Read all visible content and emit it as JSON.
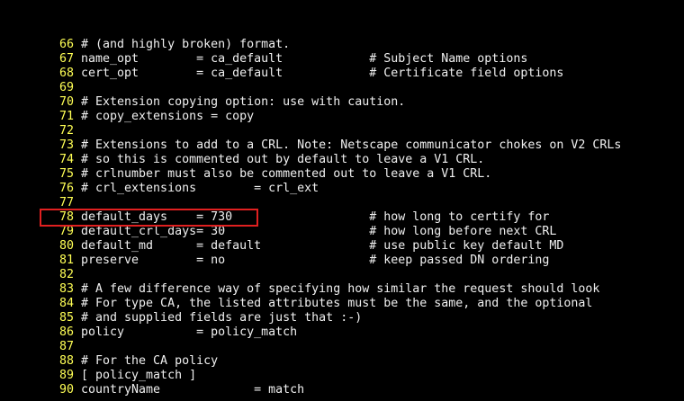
{
  "editor": {
    "lines": [
      {
        "num": "66",
        "text": "# (and highly broken) format."
      },
      {
        "num": "67",
        "text": "name_opt        = ca_default            # Subject Name options"
      },
      {
        "num": "68",
        "text": "cert_opt        = ca_default            # Certificate field options"
      },
      {
        "num": "69",
        "text": ""
      },
      {
        "num": "70",
        "text": "# Extension copying option: use with caution."
      },
      {
        "num": "71",
        "text": "# copy_extensions = copy"
      },
      {
        "num": "72",
        "text": ""
      },
      {
        "num": "73",
        "text": "# Extensions to add to a CRL. Note: Netscape communicator chokes on V2 CRLs"
      },
      {
        "num": "74",
        "text": "# so this is commented out by default to leave a V1 CRL."
      },
      {
        "num": "75",
        "text": "# crlnumber must also be commented out to leave a V1 CRL."
      },
      {
        "num": "76",
        "text": "# crl_extensions        = crl_ext"
      },
      {
        "num": "77",
        "text": ""
      },
      {
        "num": "78",
        "text": "default_days    = 730                   # how long to certify for"
      },
      {
        "num": "79",
        "text": "default_crl_days= 30                    # how long before next CRL"
      },
      {
        "num": "80",
        "text": "default_md      = default               # use public key default MD"
      },
      {
        "num": "81",
        "text": "preserve        = no                    # keep passed DN ordering"
      },
      {
        "num": "82",
        "text": ""
      },
      {
        "num": "83",
        "text": "# A few difference way of specifying how similar the request should look"
      },
      {
        "num": "84",
        "text": "# For type CA, the listed attributes must be the same, and the optional"
      },
      {
        "num": "85",
        "text": "# and supplied fields are just that :-)"
      },
      {
        "num": "86",
        "text": "policy          = policy_match"
      },
      {
        "num": "87",
        "text": ""
      },
      {
        "num": "88",
        "text": "# For the CA policy"
      },
      {
        "num": "89",
        "text": "[ policy_match ]"
      },
      {
        "num": "90",
        "text": "countryName             = match"
      }
    ],
    "highlighted_line": "78"
  },
  "colors": {
    "background": "#000000",
    "text": "#f0f0f0",
    "line_number": "#ffff55",
    "highlight_border": "#e02020"
  }
}
